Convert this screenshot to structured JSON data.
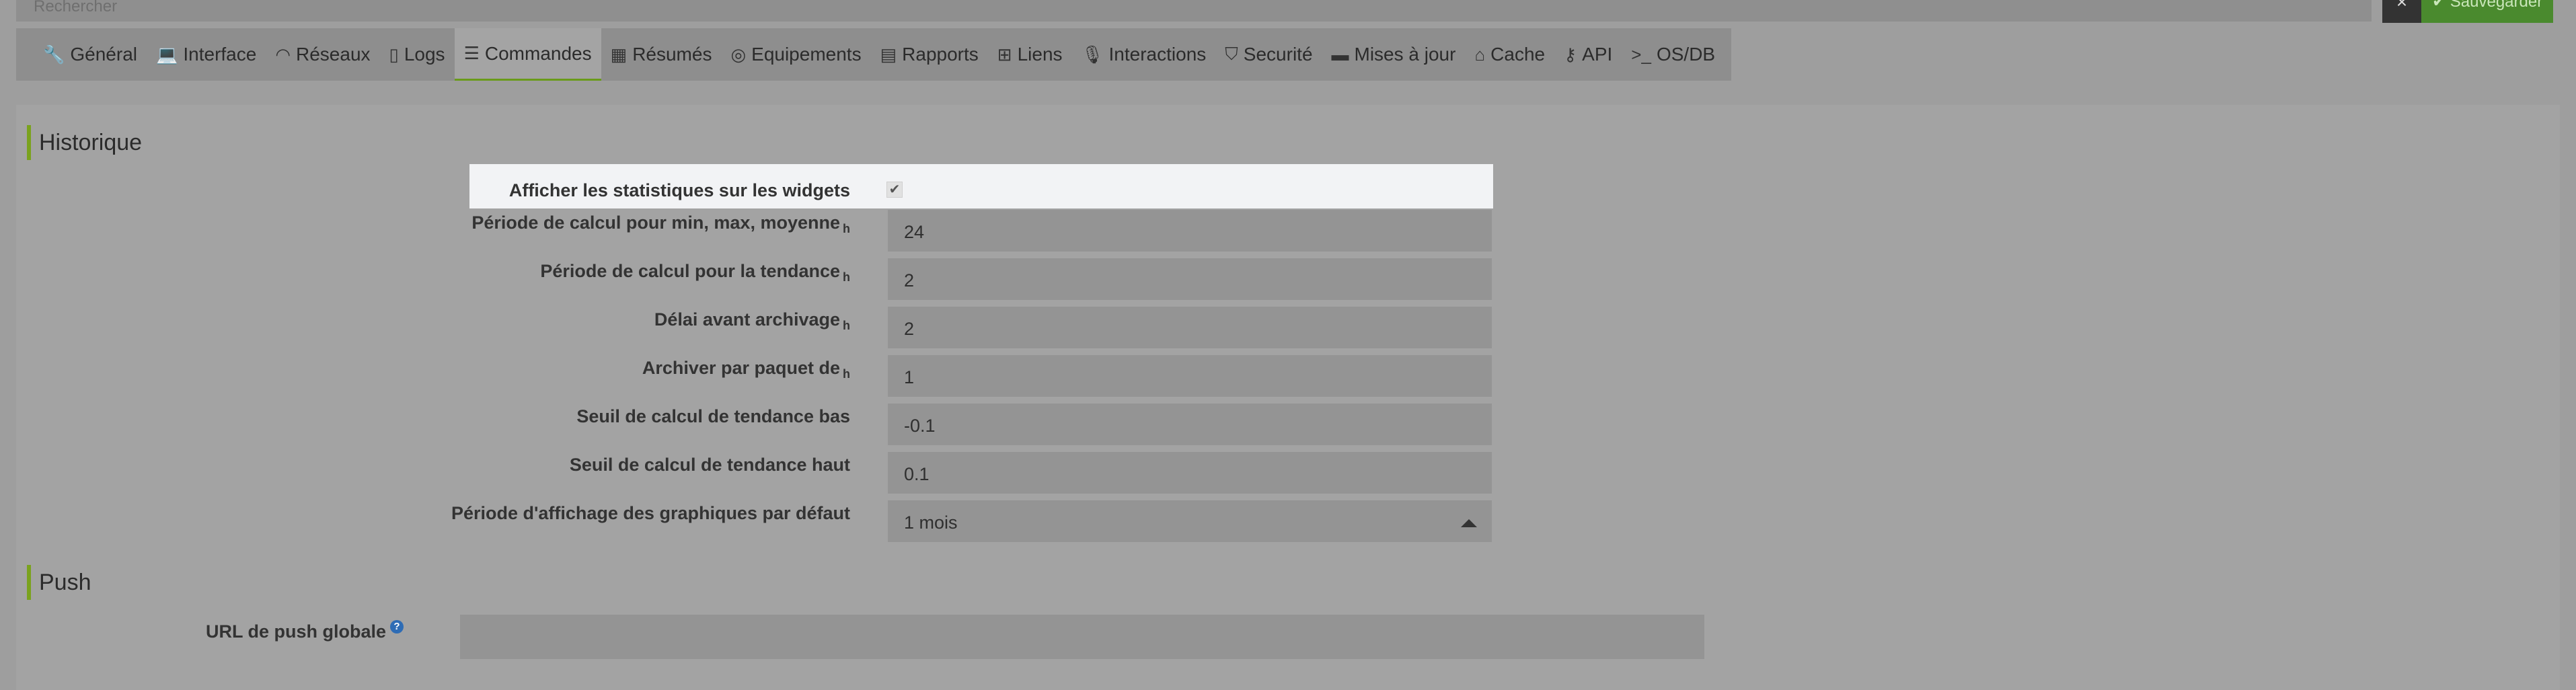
{
  "search": {
    "placeholder": "Rechercher"
  },
  "actions": {
    "close_label": "×",
    "save_label": "Sauvegarder"
  },
  "tabs": [
    {
      "label": "Général",
      "icon": "wrench-icon"
    },
    {
      "label": "Interface",
      "icon": "laptop-icon"
    },
    {
      "label": "Réseaux",
      "icon": "rss-icon"
    },
    {
      "label": "Logs",
      "icon": "file-icon"
    },
    {
      "label": "Commandes",
      "icon": "list-icon",
      "active": true
    },
    {
      "label": "Résumés",
      "icon": "table-icon"
    },
    {
      "label": "Equipements",
      "icon": "target-icon"
    },
    {
      "label": "Rapports",
      "icon": "newspaper-icon"
    },
    {
      "label": "Liens",
      "icon": "sitemap-icon"
    },
    {
      "label": "Interactions",
      "icon": "microphone-icon"
    },
    {
      "label": "Securité",
      "icon": "shield-icon"
    },
    {
      "label": "Mises à jour",
      "icon": "credit-card-icon"
    },
    {
      "label": "Cache",
      "icon": "hdd-icon"
    },
    {
      "label": "API",
      "icon": "key-icon"
    },
    {
      "label": "OS/DB",
      "icon": "terminal-icon"
    }
  ],
  "historique": {
    "title": "Historique",
    "show_stats_label": "Afficher les statistiques sur les widgets",
    "show_stats_checked": true,
    "fields": [
      {
        "label": "Période de calcul pour min, max, moyenne",
        "unit": "h",
        "value": "24"
      },
      {
        "label": "Période de calcul pour la tendance",
        "unit": "h",
        "value": "2"
      },
      {
        "label": "Délai avant archivage",
        "unit": "h",
        "value": "2"
      },
      {
        "label": "Archiver par paquet de",
        "unit": "h",
        "value": "1"
      },
      {
        "label": "Seuil de calcul de tendance bas",
        "unit": "",
        "value": "-0.1"
      },
      {
        "label": "Seuil de calcul de tendance haut",
        "unit": "",
        "value": "0.1"
      }
    ],
    "graph_period_label": "Période d'affichage des graphiques par défaut",
    "graph_period_value": "1 mois"
  },
  "push": {
    "title": "Push",
    "url_label": "URL de push globale",
    "url_value": "",
    "help_icon": "?"
  },
  "colors": {
    "accent": "#7aa21d",
    "save": "#4a8a2e",
    "overlay": "#9e9e9e"
  }
}
